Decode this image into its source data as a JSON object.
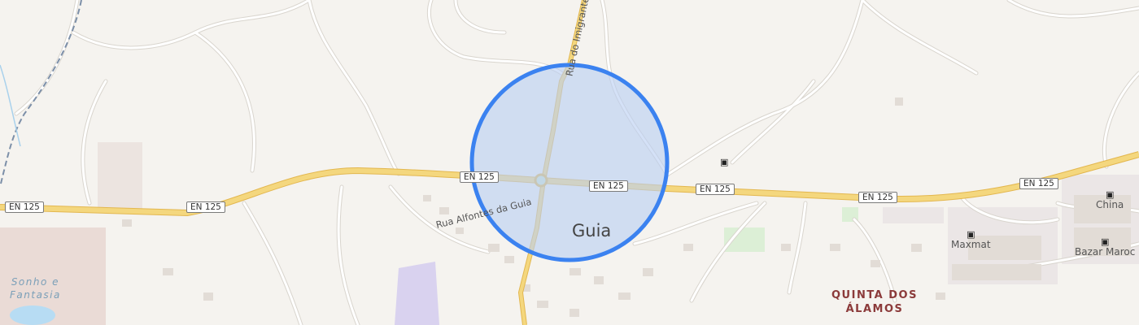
{
  "map": {
    "route_shields": [
      "EN 125",
      "EN 125",
      "EN 125",
      "EN 125",
      "EN 125",
      "EN 125",
      "EN 125"
    ],
    "city_label": "Guia",
    "streets": {
      "north": "Rua do Imigrante",
      "west": "Rua Alfontes da Guia"
    },
    "pois": [
      {
        "name": "China",
        "icon": "shopping-basket-icon"
      },
      {
        "name": "Maxmat",
        "icon": "shopping-basket-icon"
      },
      {
        "name": "Bazar Maroc",
        "icon": "shopping-basket-icon"
      },
      {
        "name": "",
        "icon": "shopping-basket-icon"
      }
    ],
    "district_lines": [
      "QUINTA DOS",
      "ÁLAMOS"
    ],
    "park_lines": [
      "Sonho e",
      "Fantasia"
    ],
    "highlight": {
      "fill": "#b9cff2",
      "stroke": "#3b82f0"
    },
    "colors": {
      "land": "#f5f3ef",
      "highway": "#f4d77e",
      "highway_casing": "#e3b74f",
      "road": "#ffffff",
      "road_casing": "#d9d5ce",
      "water": "#b7dcf3",
      "rail": "#7c8fa8"
    }
  }
}
